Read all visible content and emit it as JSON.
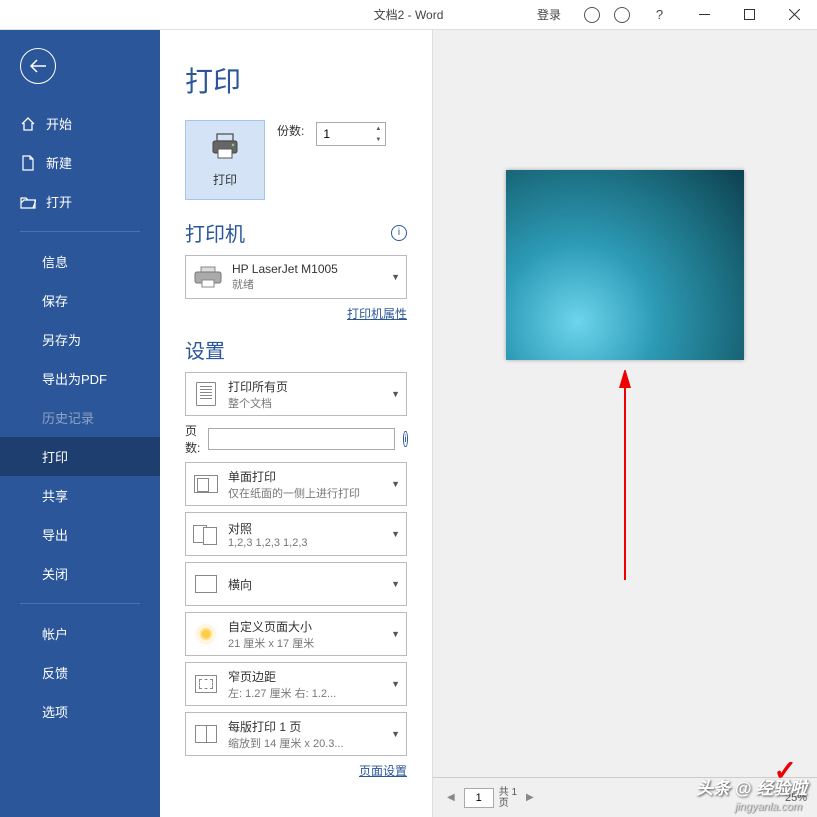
{
  "titlebar": {
    "title": "文档2 - Word",
    "login": "登录",
    "help": "?"
  },
  "sidebar": {
    "home": "开始",
    "new": "新建",
    "open": "打开",
    "info": "信息",
    "save": "保存",
    "saveas": "另存为",
    "exportpdf": "导出为PDF",
    "history": "历史记录",
    "print": "打印",
    "share": "共享",
    "export": "导出",
    "close": "关闭",
    "account": "帐户",
    "feedback": "反馈",
    "options": "选项"
  },
  "content": {
    "page_title": "打印",
    "print_button": "打印",
    "copies_label": "份数:",
    "copies_value": "1",
    "printer_section": "打印机",
    "printer_name": "HP LaserJet M1005",
    "printer_status": "就绪",
    "printer_props": "打印机属性",
    "settings_section": "设置",
    "pages_label": "页数:",
    "page_setup": "页面设置",
    "options": {
      "print_all": {
        "main": "打印所有页",
        "sub": "整个文档"
      },
      "single_side": {
        "main": "单面打印",
        "sub": "仅在纸面的一侧上进行打印"
      },
      "collate": {
        "main": "对照",
        "sub": "1,2,3    1,2,3    1,2,3"
      },
      "orientation": {
        "main": "横向",
        "sub": ""
      },
      "size": {
        "main": "自定义页面大小",
        "sub": "21 厘米 x 17 厘米"
      },
      "margins": {
        "main": "窄页边距",
        "sub": "左: 1.27 厘米   右: 1.2..."
      },
      "pages_per": {
        "main": "每版打印 1 页",
        "sub": "缩放到 14 厘米 x 20.3..."
      }
    }
  },
  "preview": {
    "page_num": "1",
    "total_label": "共 1",
    "total_label2": "页",
    "zoom": "25%",
    "watermark_top": "头条 @ 经验啦",
    "watermark_bottom": "jingyanla.com"
  }
}
